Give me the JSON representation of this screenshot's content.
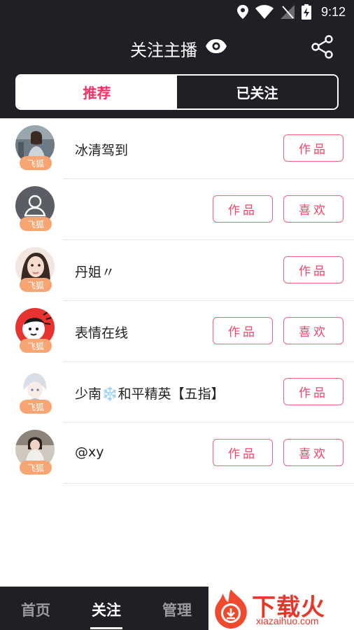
{
  "status_bar": {
    "time": "9:12"
  },
  "header": {
    "title": "关注主播"
  },
  "tabs": [
    {
      "label": "推荐",
      "active": true
    },
    {
      "label": "已关注",
      "active": false
    }
  ],
  "badge_label": "飞狐",
  "anchors": [
    {
      "name": "冰清驾到",
      "works_label": "作品",
      "likes_label": ""
    },
    {
      "name": "",
      "works_label": "作品",
      "likes_label": "喜欢"
    },
    {
      "name": "丹姐〃",
      "works_label": "作品",
      "likes_label": ""
    },
    {
      "name": "表情在线",
      "works_label": "作品",
      "likes_label": "喜欢"
    },
    {
      "name": "少南❄️和平精英【五指】",
      "works_label": "作品",
      "likes_label": ""
    },
    {
      "name": "@xy",
      "works_label": "作品",
      "likes_label": "喜欢"
    }
  ],
  "bottom_nav": [
    {
      "label": "首页",
      "active": false
    },
    {
      "label": "关注",
      "active": true
    },
    {
      "label": "管理",
      "active": false
    }
  ],
  "watermark": {
    "brand": "下载火",
    "url": "xiazaihuo.com"
  },
  "colors": {
    "header_bg": "#1f2026",
    "accent_pink": "#ff2d63",
    "badge_orange": "#f7a572",
    "button_border": "#f0637a"
  }
}
